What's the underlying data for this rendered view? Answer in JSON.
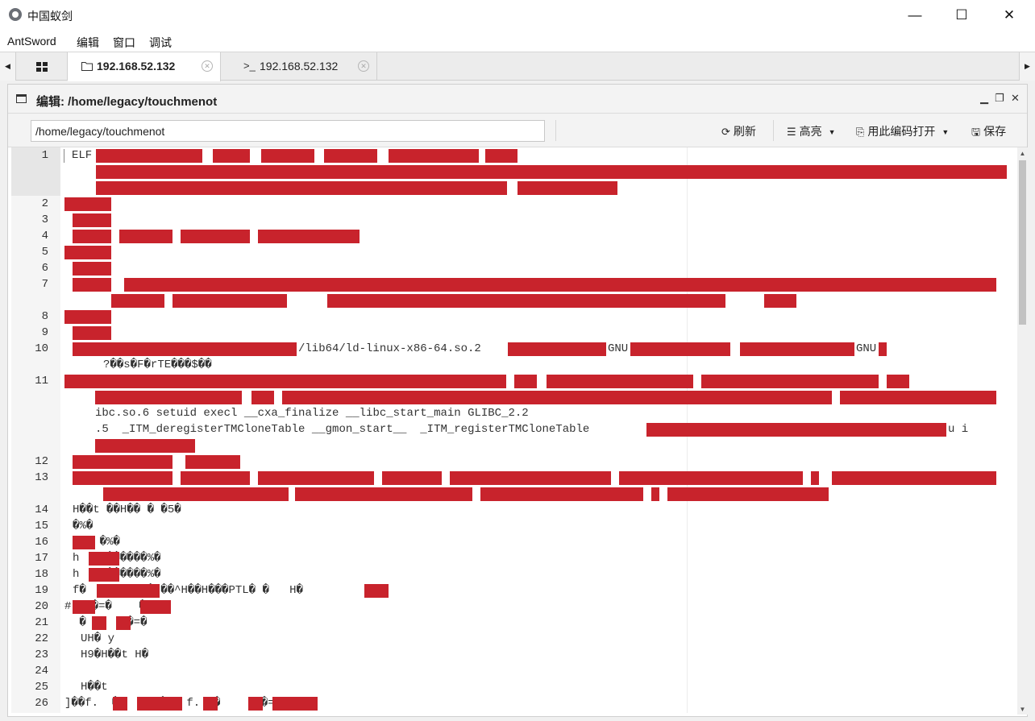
{
  "window": {
    "title": "中国蚁剑",
    "minimize_glyph": "—",
    "maximize_glyph": "☐",
    "close_glyph": "✕"
  },
  "menu": [
    "AntSword",
    "编辑",
    "窗口",
    "调试"
  ],
  "tabs": {
    "left_arrow": "◀",
    "right_arrow": "▶",
    "grid_icon": "grid-icon",
    "items": [
      {
        "label": "192.168.52.132",
        "icon": "folder-icon",
        "active": true
      },
      {
        "label": "192.168.52.132",
        "icon": "terminal-icon",
        "active": false
      }
    ],
    "terminal_prefix": ">_",
    "close_glyph": "✕"
  },
  "editor_panel": {
    "title": "编辑: /home/legacy/touchmenot",
    "path_value": "/home/legacy/touchmenot",
    "refresh_label": "刷新",
    "highlight_label": "高亮",
    "encoding_label": "用此编码打开",
    "save_label": "保存"
  },
  "line_numbers": [
    "1",
    "2",
    "3",
    "4",
    "5",
    "6",
    "7",
    "8",
    "9",
    "10",
    "11",
    "12",
    "13",
    "14",
    "15",
    "16",
    "17",
    "18",
    "19",
    "20",
    "21",
    "22",
    "23",
    "24",
    "25",
    "26"
  ],
  "code_text": {
    "l1": "ELF",
    "l10_a": "/lib64/ld-linux-x86-64.so.2",
    "l10_b": "GNU",
    "l10_c": "GNU",
    "l11_a": "?��s�F�rTE���$��",
    "l11_b": "ibc.so.6 setuid execl __cxa_finalize __libc_start_main GLIBC_2.2",
    "l11_c": ".5  _ITM_deregisterTMCloneTable __gmon_start__  _ITM_registerTMCloneTable",
    "l11_d": "u i",
    "l14": "H��t ��H�� � �5�",
    "l15": "�%�",
    "l16": "  @ �%�",
    "l17": "h    ������%�",
    "l18": "h    ������%�",
    "l19": "f�        1�I��^H��H���PTL� �   H�",
    "l20": "#  H�=�    �6",
    "l21": " �  D  H�=�",
    "l22": "UH� y",
    "l23": "H9�H��t H�",
    "l25": "H��t",
    "l26": "]��f.  �     ]� @ f.  �     H�=A"
  }
}
